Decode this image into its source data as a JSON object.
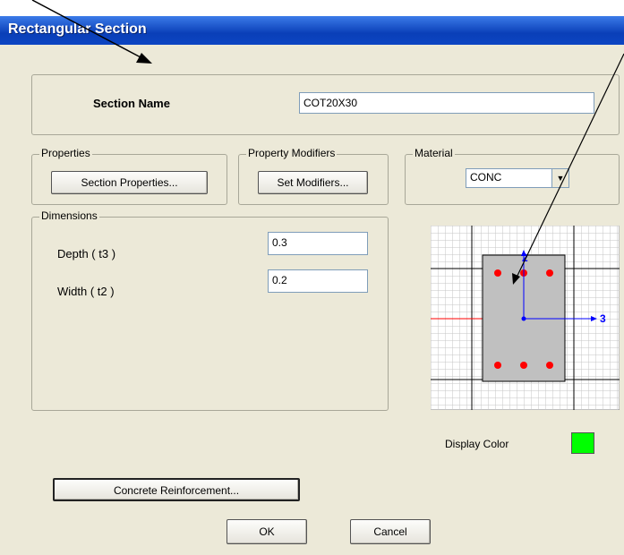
{
  "window": {
    "title": "Rectangular Section"
  },
  "section_name": {
    "label": "Section Name",
    "value": "COT20X30"
  },
  "properties": {
    "group_label": "Properties",
    "button_label": "Section Properties..."
  },
  "property_modifiers": {
    "group_label": "Property Modifiers",
    "button_label": "Set Modifiers..."
  },
  "material": {
    "group_label": "Material",
    "selected": "CONC"
  },
  "dimensions": {
    "group_label": "Dimensions",
    "depth_label": "Depth  ( t3 )",
    "depth_value": "0.3",
    "width_label": "Width  ( t2 )",
    "width_value": "0.2"
  },
  "preview": {
    "axis2_label": "2",
    "axis3_label": "3"
  },
  "display_color": {
    "label": "Display Color",
    "color": "#00ff00"
  },
  "buttons": {
    "reinforcement": "Concrete Reinforcement...",
    "ok": "OK",
    "cancel": "Cancel"
  }
}
